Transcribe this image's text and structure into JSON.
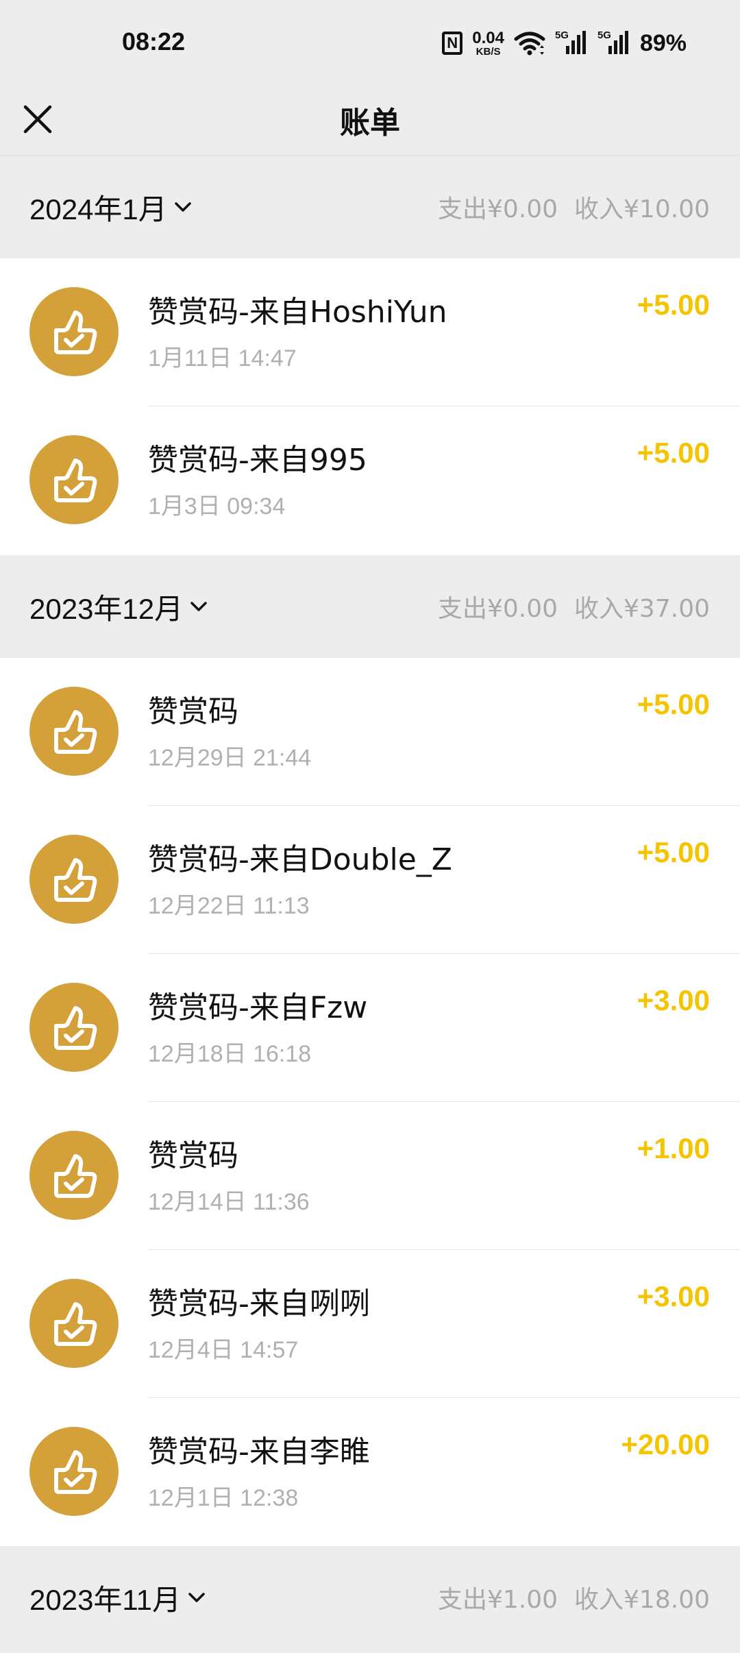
{
  "status_bar": {
    "time": "08:22",
    "net_speed_value": "0.04",
    "net_speed_unit": "KB/S",
    "nfc_label": "N",
    "signal1_label": "5G",
    "signal2_label": "5G",
    "battery": "89%"
  },
  "header": {
    "title": "账单",
    "close_icon": "close-icon"
  },
  "colors": {
    "accent_amount": "#f5c400",
    "avatar_bg": "#d4a03a",
    "section_bg": "#ededed"
  },
  "months": [
    {
      "label": "2024年1月",
      "expense": "支出¥0.00",
      "income": "收入¥10.00",
      "transactions": [
        {
          "title": "赞赏码-来自HoshiYun",
          "time": "1月11日 14:47",
          "amount": "+5.00"
        },
        {
          "title": "赞赏码-来自995",
          "time": "1月3日 09:34",
          "amount": "+5.00"
        }
      ]
    },
    {
      "label": "2023年12月",
      "expense": "支出¥0.00",
      "income": "收入¥37.00",
      "transactions": [
        {
          "title": "赞赏码",
          "time": "12月29日 21:44",
          "amount": "+5.00"
        },
        {
          "title": "赞赏码-来自Double_Z",
          "time": "12月22日 11:13",
          "amount": "+5.00"
        },
        {
          "title": "赞赏码-来自Fzw",
          "time": "12月18日 16:18",
          "amount": "+3.00"
        },
        {
          "title": "赞赏码",
          "time": "12月14日 11:36",
          "amount": "+1.00"
        },
        {
          "title": "赞赏码-来自咧咧",
          "time": "12月4日 14:57",
          "amount": "+3.00"
        },
        {
          "title": "赞赏码-来自李睢",
          "time": "12月1日 12:38",
          "amount": "+20.00"
        }
      ]
    },
    {
      "label": "2023年11月",
      "expense": "支出¥1.00",
      "income": "收入¥18.00",
      "transactions": []
    }
  ]
}
